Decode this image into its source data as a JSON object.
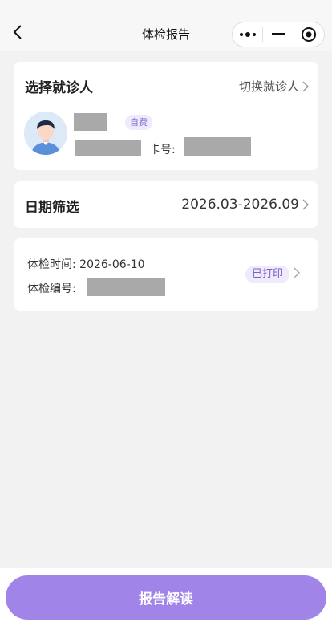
{
  "navbar": {
    "title": "体检报告",
    "back_icon": "chevron-left-icon",
    "capsule_icons": [
      "more-dots-icon",
      "minimize-icon",
      "close-circle-icon"
    ]
  },
  "patient": {
    "title": "选择就诊人",
    "switch_label": "切换就诊人",
    "tag": "自费",
    "card_no_label": "卡号:"
  },
  "date_filter": {
    "label": "日期筛选",
    "value": "2026.03-2026.09"
  },
  "report": {
    "time_label": "体检时间:",
    "time_value": "2026-06-10",
    "number_label": "体检编号:",
    "status": "已打印"
  },
  "bottom": {
    "button_label": "报告解读"
  },
  "colors": {
    "accent": "#a084e8",
    "tag_bg": "#efeafc",
    "tag_text": "#8a6fd6",
    "page_bg": "#f2f2f2"
  }
}
